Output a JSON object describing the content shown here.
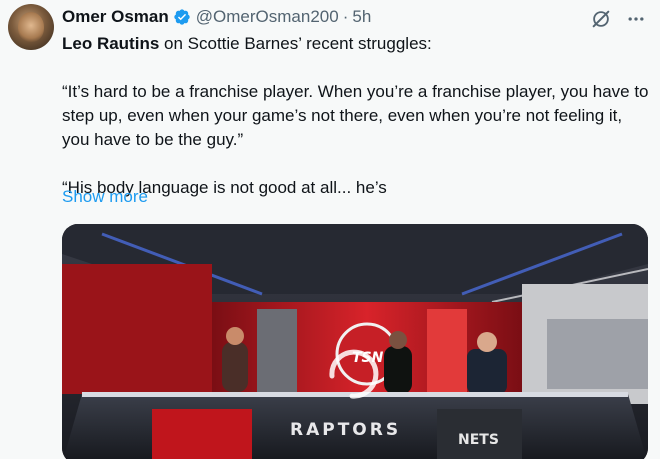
{
  "author": {
    "name": "Omer Osman",
    "handle": "@OmerOsman200",
    "separator": "·",
    "time": "5h"
  },
  "tweet": {
    "line1_bold": "Leo Rautins",
    "line1_rest": " on Scottie Barnes’ recent struggles:",
    "quote1": "“It’s hard to be a franchise player. When you’re a franchise player, you have to step up, even when your game’s not there, even when you’re not feeling it, you have to be the guy.”",
    "quote2": "“His body language is not good at all... he’s",
    "show_more": "Show more"
  },
  "media": {
    "desk_label": "RAPTORS",
    "logo_text": "TSN",
    "nets_label": "NETS"
  },
  "colors": {
    "link": "#1d9bf0",
    "secondary": "#536471",
    "verified": "#1d9bf0"
  },
  "icons": [
    "verified-badge-icon",
    "grok-icon",
    "more-icon",
    "loading-spinner-icon"
  ]
}
